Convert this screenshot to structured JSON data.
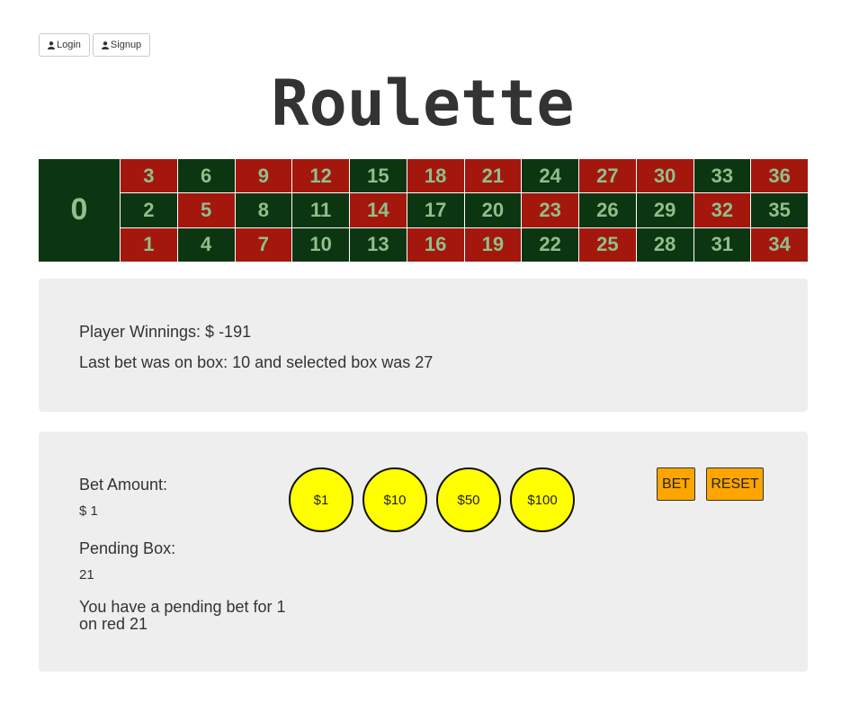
{
  "auth": {
    "login_label": "Login",
    "signup_label": "Signup"
  },
  "title": "Roulette",
  "board": {
    "zero": "0",
    "rows": [
      [
        {
          "n": "3",
          "c": "red"
        },
        {
          "n": "6",
          "c": "green"
        },
        {
          "n": "9",
          "c": "red"
        },
        {
          "n": "12",
          "c": "red"
        },
        {
          "n": "15",
          "c": "green"
        },
        {
          "n": "18",
          "c": "red"
        },
        {
          "n": "21",
          "c": "red"
        },
        {
          "n": "24",
          "c": "green"
        },
        {
          "n": "27",
          "c": "red"
        },
        {
          "n": "30",
          "c": "red"
        },
        {
          "n": "33",
          "c": "green"
        },
        {
          "n": "36",
          "c": "red"
        }
      ],
      [
        {
          "n": "2",
          "c": "green"
        },
        {
          "n": "5",
          "c": "red"
        },
        {
          "n": "8",
          "c": "green"
        },
        {
          "n": "11",
          "c": "green"
        },
        {
          "n": "14",
          "c": "red"
        },
        {
          "n": "17",
          "c": "green"
        },
        {
          "n": "20",
          "c": "green"
        },
        {
          "n": "23",
          "c": "red"
        },
        {
          "n": "26",
          "c": "green"
        },
        {
          "n": "29",
          "c": "green"
        },
        {
          "n": "32",
          "c": "red"
        },
        {
          "n": "35",
          "c": "green"
        }
      ],
      [
        {
          "n": "1",
          "c": "red"
        },
        {
          "n": "4",
          "c": "green"
        },
        {
          "n": "7",
          "c": "red"
        },
        {
          "n": "10",
          "c": "green"
        },
        {
          "n": "13",
          "c": "green"
        },
        {
          "n": "16",
          "c": "red"
        },
        {
          "n": "19",
          "c": "red"
        },
        {
          "n": "22",
          "c": "green"
        },
        {
          "n": "25",
          "c": "red"
        },
        {
          "n": "28",
          "c": "green"
        },
        {
          "n": "31",
          "c": "green"
        },
        {
          "n": "34",
          "c": "red"
        }
      ]
    ]
  },
  "results": {
    "winnings_text": "Player Winnings: $ -191",
    "last_bet_text": "Last bet was on box: 10 and selected box was 27"
  },
  "bet": {
    "amount_label": "Bet Amount:",
    "amount_value": "$ 1",
    "pending_label": "Pending Box:",
    "pending_value": "21",
    "pending_message": "You have a pending bet for 1 on red 21",
    "chips": [
      "$1",
      "$10",
      "$50",
      "$100"
    ],
    "bet_label": "BET",
    "reset_label": "RESET"
  },
  "colors": {
    "red": "#a4170d",
    "green": "#0c3612",
    "chip": "#ffff00",
    "button": "#ffa500",
    "panel": "#eeeeee"
  }
}
